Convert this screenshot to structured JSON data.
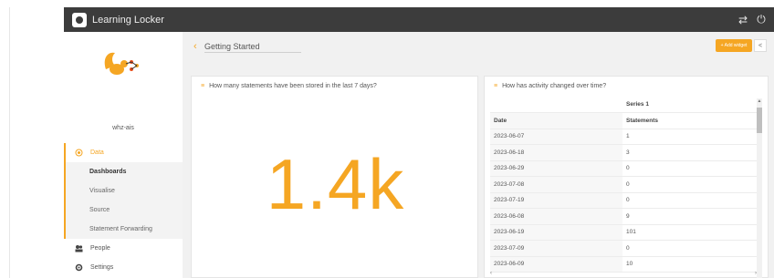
{
  "app": {
    "title": "Learning Locker"
  },
  "sidebar": {
    "org_name": "whz-ais",
    "nav": [
      {
        "label": "Data",
        "icon": "radio-icon"
      },
      {
        "label": "People",
        "icon": "people-icon"
      },
      {
        "label": "Settings",
        "icon": "gear-icon"
      }
    ],
    "data_sub": [
      "Dashboards",
      "Visualise",
      "Source",
      "Statement Forwarding"
    ]
  },
  "header": {
    "title": "Getting Started",
    "add_widget": "+ Add widget"
  },
  "widget_left": {
    "title": "How many statements have been stored in the last 7 days?",
    "value": "1.4k"
  },
  "widget_right": {
    "title": "How has activity changed over time?",
    "series_label": "Series 1",
    "col_date": "Date",
    "col_statements": "Statements",
    "rows": [
      {
        "date": "2023-06-07",
        "value": "1"
      },
      {
        "date": "2023-06-18",
        "value": "3"
      },
      {
        "date": "2023-06-29",
        "value": "0"
      },
      {
        "date": "2023-07-08",
        "value": "0"
      },
      {
        "date": "2023-07-19",
        "value": "0"
      },
      {
        "date": "2023-06-08",
        "value": "9"
      },
      {
        "date": "2023-06-19",
        "value": "101"
      },
      {
        "date": "2023-07-09",
        "value": "0"
      },
      {
        "date": "2023-06-09",
        "value": "10"
      }
    ]
  },
  "colors": {
    "accent": "#f5a623",
    "topbar": "#3c3c3c"
  }
}
